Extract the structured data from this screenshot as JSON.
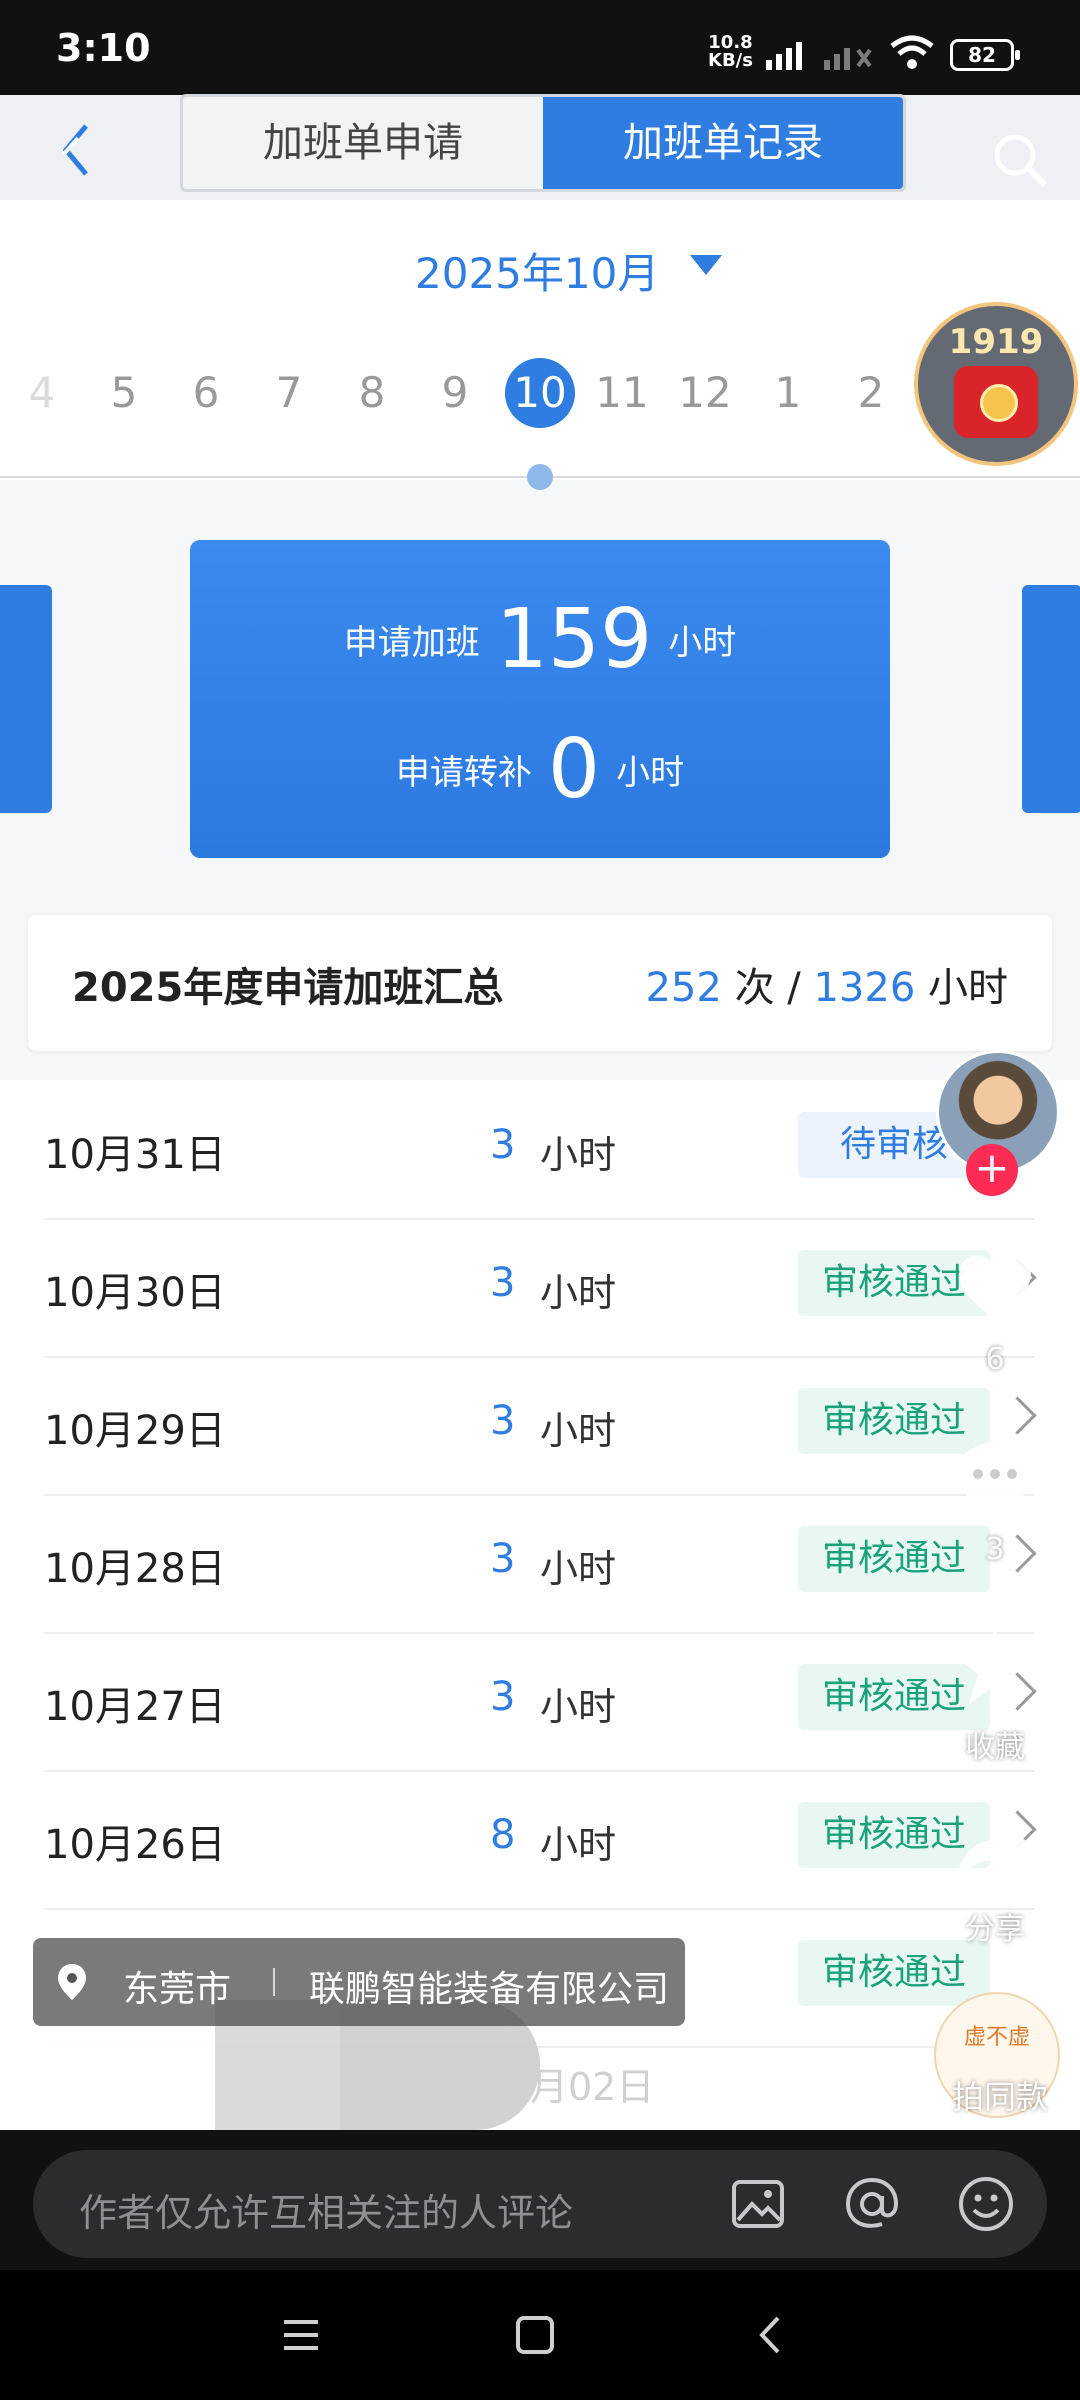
{
  "status_bar": {
    "time": "3:10",
    "speed_value": "10.8",
    "speed_unit": "KB/s",
    "battery": "82"
  },
  "header": {
    "tab_apply": "加班单申请",
    "tab_records": "加班单记录",
    "active_tab": "加班单记录"
  },
  "month_picker": {
    "label": "2025年10月",
    "days": [
      "4",
      "5",
      "6",
      "7",
      "8",
      "9",
      "10",
      "11",
      "12",
      "1",
      "2"
    ],
    "selected": "10"
  },
  "red_packet": {
    "count": "1919"
  },
  "summary": {
    "apply_overtime_label": "申请加班",
    "apply_overtime_value": "159",
    "apply_comp_label": "申请转补",
    "apply_comp_value": "0",
    "unit": "小时"
  },
  "annual": {
    "title": "2025年度申请加班汇总",
    "count": "252",
    "count_unit": "次",
    "separator": "/",
    "hours": "1326",
    "hours_unit": "小时"
  },
  "records": [
    {
      "date": "10月31日",
      "hours": "3",
      "unit": "小时",
      "status": "待审核"
    },
    {
      "date": "10月30日",
      "hours": "3",
      "unit": "小时",
      "status": "审核通过"
    },
    {
      "date": "10月29日",
      "hours": "3",
      "unit": "小时",
      "status": "审核通过"
    },
    {
      "date": "10月28日",
      "hours": "3",
      "unit": "小时",
      "status": "审核通过"
    },
    {
      "date": "10月27日",
      "hours": "3",
      "unit": "小时",
      "status": "审核通过"
    },
    {
      "date": "10月26日",
      "hours": "8",
      "unit": "小时",
      "status": "审核通过"
    },
    {
      "date": "",
      "hours": "",
      "unit": "",
      "status": "审核通过"
    }
  ],
  "video_overlay": {
    "like_count": "6",
    "comment_count": "3",
    "favorite_label": "收藏",
    "share_label": "分享",
    "same_style_label": "拍同款",
    "same_style_badge": "虚不虚",
    "location_city": "东莞市",
    "location_company": "联鹏智能装备有限公司",
    "blurred_date": "月02日"
  },
  "comment_bar": {
    "placeholder": "作者仅允许互相关注的人评论"
  },
  "colors": {
    "accent": "#2f7de1",
    "success": "#1aa37a",
    "pending_bg": "#ecf3fd"
  }
}
